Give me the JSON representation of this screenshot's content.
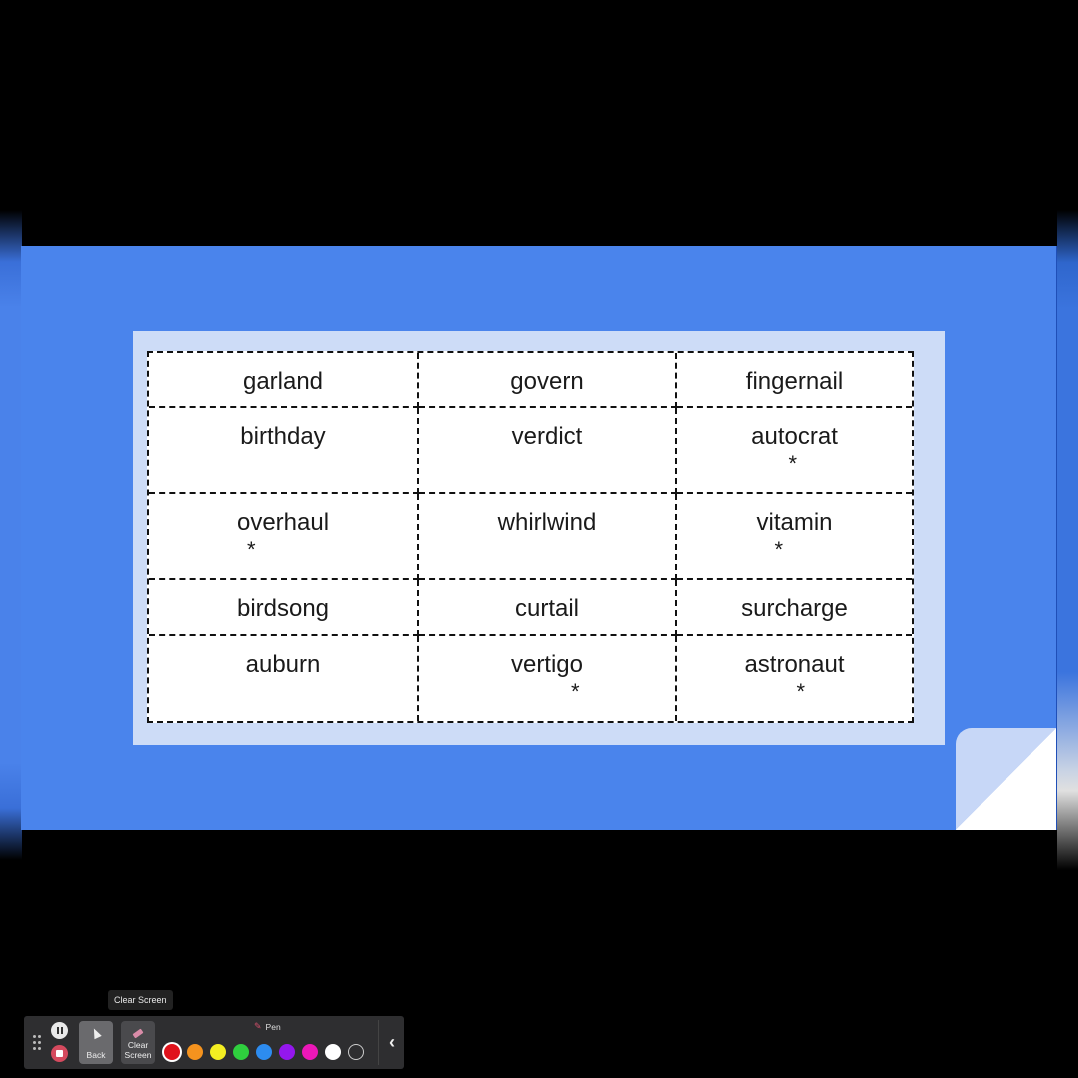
{
  "slide": {
    "background_color": "#4a84ec",
    "panel_color": "#cddcf7",
    "word_grid": {
      "rows": [
        [
          {
            "word": "garland",
            "star": false
          },
          {
            "word": "govern",
            "star": false
          },
          {
            "word": "fingernail",
            "star": false
          }
        ],
        [
          {
            "word": "birthday",
            "star": false
          },
          {
            "word": "verdict",
            "star": false
          },
          {
            "word": "autocrat",
            "star": true,
            "star_mark": "*"
          }
        ],
        [
          {
            "word": "overhaul",
            "star": true,
            "star_mark": "*"
          },
          {
            "word": "whirlwind",
            "star": false
          },
          {
            "word": "vitamin",
            "star": true,
            "star_mark": "*"
          }
        ],
        [
          {
            "word": "birdsong",
            "star": false
          },
          {
            "word": "curtail",
            "star": false
          },
          {
            "word": "surcharge",
            "star": false
          }
        ],
        [
          {
            "word": "auburn",
            "star": false
          },
          {
            "word": "vertigo",
            "star": true,
            "star_mark": "*"
          },
          {
            "word": "astronaut",
            "star": true,
            "star_mark": "*"
          }
        ]
      ]
    }
  },
  "toolbar": {
    "tooltip": "Clear Screen",
    "pause_icon": "pause-icon",
    "stop_icon": "stop-icon",
    "back_label": "Back",
    "clear_label": "Clear Screen",
    "pen_label": "Pen",
    "colors": [
      {
        "name": "red",
        "hex": "#e0121b",
        "selected": true
      },
      {
        "name": "orange",
        "hex": "#f5931e",
        "selected": false
      },
      {
        "name": "yellow",
        "hex": "#f4ee22",
        "selected": false
      },
      {
        "name": "green",
        "hex": "#2fcf3e",
        "selected": false
      },
      {
        "name": "blue",
        "hex": "#2d8cf0",
        "selected": false
      },
      {
        "name": "purple",
        "hex": "#9417ee",
        "selected": false
      },
      {
        "name": "magenta",
        "hex": "#ec17b8",
        "selected": false
      },
      {
        "name": "white",
        "hex": "#ffffff",
        "selected": false
      },
      {
        "name": "none",
        "hex": "transparent",
        "selected": false
      }
    ],
    "collapse_icon": "chevron-left-icon"
  }
}
